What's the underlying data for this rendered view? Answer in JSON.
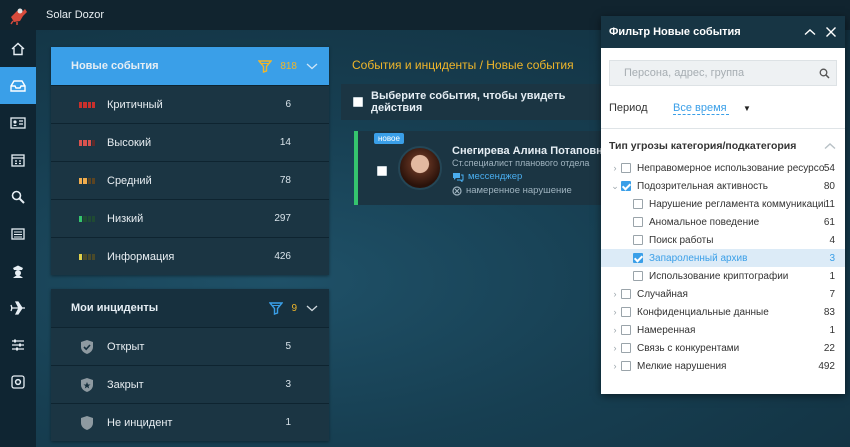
{
  "app": {
    "title": "Solar Dozor"
  },
  "colors": {
    "accent": "#3a9fe8",
    "highlight": "#f0b62a",
    "green": "#35c46e"
  },
  "nav": [
    {
      "name": "home-icon"
    },
    {
      "name": "inbox-icon"
    },
    {
      "name": "id-card-icon"
    },
    {
      "name": "calendar-icon"
    },
    {
      "name": "search-icon"
    },
    {
      "name": "list-icon"
    },
    {
      "name": "police-icon"
    },
    {
      "name": "plane-icon"
    },
    {
      "name": "sliders-icon"
    },
    {
      "name": "gear-icon"
    }
  ],
  "new_events": {
    "title": "Новые события",
    "count": "818",
    "rows": [
      {
        "label": "Критичный",
        "count": "6",
        "color": "#c9302c"
      },
      {
        "label": "Высокий",
        "count": "14",
        "color": "#d9534f"
      },
      {
        "label": "Средний",
        "count": "78",
        "color": "#f0ad4e"
      },
      {
        "label": "Низкий",
        "count": "297",
        "color": "#35c46e"
      },
      {
        "label": "Информация",
        "count": "426",
        "color": "#e0d14a"
      }
    ]
  },
  "incidents": {
    "title": "Мои инциденты",
    "count": "9",
    "rows": [
      {
        "label": "Открыт",
        "count": "5"
      },
      {
        "label": "Закрыт",
        "count": "3"
      },
      {
        "label": "Не инцидент",
        "count": "1"
      }
    ]
  },
  "main": {
    "breadcrumb": "События и инциденты / Новые события",
    "select_prompt": "Выберите события, чтобы увидеть действия",
    "event": {
      "badge": "новое",
      "name": "Снегирева Алина Потаповна",
      "role": "Ст.специалист планового отдела",
      "channel": "мессенджер",
      "violation": "намеренное нарушение"
    }
  },
  "filter": {
    "title": "Фильтр Новые события",
    "search_placeholder": "Персона, адрес, группа",
    "period_label": "Период",
    "period_value": "Все время",
    "group_title": "Тип угрозы категория/подкатегория",
    "items": [
      {
        "label": "Неправомерное использование ресурсов",
        "count": "54"
      },
      {
        "label": "Подозрительная активность",
        "count": "80"
      },
      {
        "label": "Нарушение регламента коммуникаций",
        "count": "11"
      },
      {
        "label": "Аномальное поведение",
        "count": "61"
      },
      {
        "label": "Поиск работы",
        "count": "4"
      },
      {
        "label": "Запароленный архив",
        "count": "3"
      },
      {
        "label": "Использование криптографии",
        "count": "1"
      },
      {
        "label": "Случайная",
        "count": "7"
      },
      {
        "label": "Конфиденциальные данные",
        "count": "83"
      },
      {
        "label": "Намеренная",
        "count": "1"
      },
      {
        "label": "Связь с конкурентами",
        "count": "22"
      },
      {
        "label": "Мелкие нарушения",
        "count": "492"
      }
    ]
  }
}
